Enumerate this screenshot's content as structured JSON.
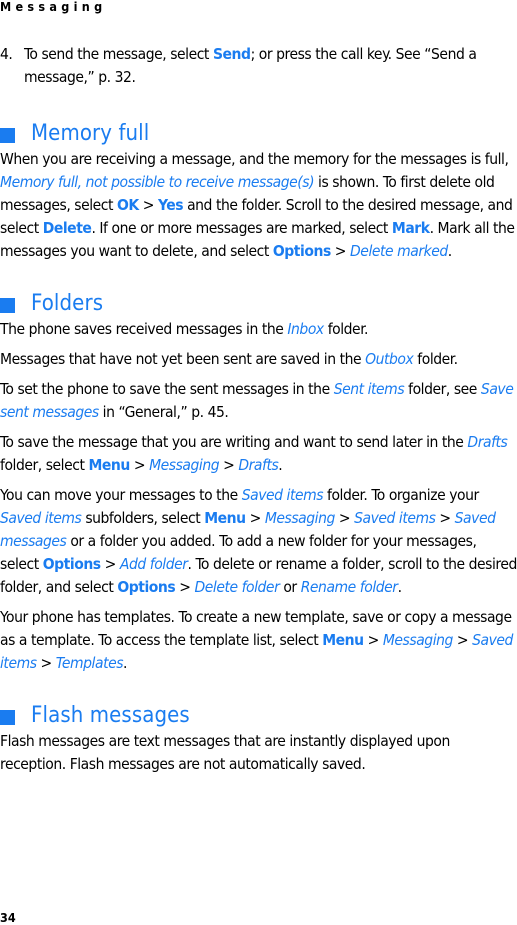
{
  "header": {
    "running_title": "Messaging"
  },
  "step4": {
    "number": "4.",
    "t1": "To send the message, select ",
    "send": "Send",
    "t2": "; or press the call key. See “Send a message,” p. 32."
  },
  "memory_full": {
    "heading": "Memory full",
    "t1": "When you are receiving a message, and the memory for the messages is full, ",
    "notice": "Memory full, not possible to receive message(s)",
    "t2": " is shown. To first delete old messages, select ",
    "ok": "OK",
    "gt1": " > ",
    "yes": "Yes",
    "t3": " and the folder. Scroll to the desired message, and select ",
    "delete": "Delete",
    "t4": ". If one or more messages are marked, select ",
    "mark": "Mark",
    "t5": ". Mark all the messages you want to delete, and select ",
    "options": "Options",
    "gt2": " > ",
    "delete_marked": "Delete marked",
    "t6": "."
  },
  "folders": {
    "heading": "Folders",
    "p1": {
      "t1": "The phone saves received messages in the ",
      "inbox": "Inbox",
      "t2": " folder."
    },
    "p2": {
      "t1": "Messages that have not yet been sent are saved in the ",
      "outbox": "Outbox",
      "t2": " folder."
    },
    "p3": {
      "t1": "To set the phone to save the sent messages in the ",
      "sent_items": "Sent items",
      "t2": " folder, see ",
      "save_sent": "Save sent messages",
      "t3": " in “General,” p. 45."
    },
    "p4": {
      "t1": "To save the message that you are writing and want to send later in the ",
      "drafts": "Drafts",
      "t2": " folder, select ",
      "menu": "Menu",
      "gt1": " > ",
      "messaging": "Messaging",
      "gt2": " > ",
      "drafts2": "Drafts",
      "t3": "."
    },
    "p5": {
      "t1": "You can move your messages to the ",
      "saved_items": "Saved items",
      "t2": " folder. To organize your ",
      "saved_items2": "Saved items",
      "t3": " subfolders, select ",
      "menu": "Menu",
      "gt1": " > ",
      "messaging": "Messaging",
      "gt2": " > ",
      "saved_items3": "Saved items",
      "gt3": " > ",
      "saved_messages": "Saved messages",
      "t4": " or a folder you added. To add a new folder for your messages, select ",
      "options": "Options",
      "gt4": " > ",
      "add_folder": "Add folder",
      "t5": ". To delete or rename a folder, scroll to the desired folder, and select ",
      "options2": "Options",
      "gt5": " > ",
      "delete_folder": "Delete folder",
      "t6": " or ",
      "rename_folder": "Rename folder",
      "t7": "."
    },
    "p6": {
      "t1": "Your phone has templates. To create a new template, save or copy a message as a template. To access the template list, select ",
      "menu": "Menu",
      "gt1": " > ",
      "messaging": "Messaging",
      "gt2": " > ",
      "saved_items": "Saved items",
      "gt3": " > ",
      "templates": "Templates",
      "t2": "."
    }
  },
  "flash": {
    "heading": "Flash messages",
    "body": "Flash messages are text messages that are instantly displayed upon reception. Flash messages are not automatically saved."
  },
  "footer": {
    "page_number": "34"
  }
}
